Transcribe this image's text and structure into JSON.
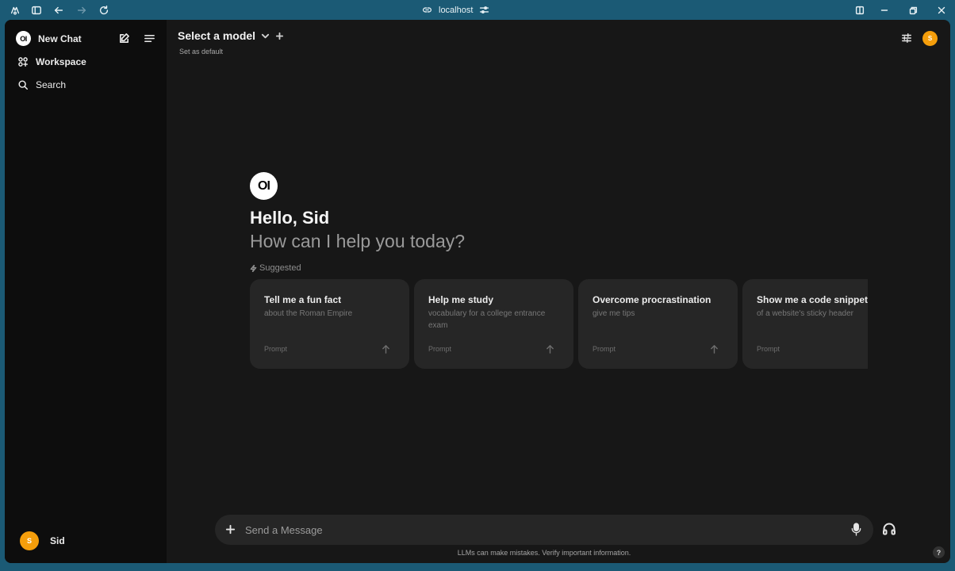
{
  "browser": {
    "url": "localhost",
    "icons": [
      "extensions-icon",
      "sidebar-toggle-icon",
      "back-arrow-icon",
      "forward-arrow-icon",
      "reload-icon",
      "link-icon",
      "settings-sliders-icon",
      "split-view-icon",
      "minimize-icon",
      "restore-icon",
      "close-icon"
    ]
  },
  "sidebar": {
    "logo": "OI",
    "new_chat": "New Chat",
    "workspace": "Workspace",
    "search": "Search",
    "user": {
      "initial": "S",
      "name": "Sid"
    }
  },
  "header": {
    "model_select": "Select a model",
    "set_default": "Set as default",
    "avatar_initial": "S"
  },
  "hero": {
    "logo": "OI",
    "greeting": "Hello, Sid",
    "subtitle": "How can I help you today?",
    "suggested_label": "Suggested"
  },
  "suggestions": [
    {
      "title": "Tell me a fun fact",
      "subtitle": "about the Roman Empire",
      "tag": "Prompt"
    },
    {
      "title": "Help me study",
      "subtitle": "vocabulary for a college entrance exam",
      "tag": "Prompt"
    },
    {
      "title": "Overcome procrastination",
      "subtitle": "give me tips",
      "tag": "Prompt"
    },
    {
      "title": "Show me a code snippet",
      "subtitle": "of a website's sticky header",
      "tag": "Prompt"
    }
  ],
  "composer": {
    "placeholder": "Send a Message",
    "disclaimer": "LLMs can make mistakes. Verify important information.",
    "help": "?"
  },
  "colors": {
    "titlebar": "#1b5a75",
    "sidebar": "#0d0d0d",
    "main": "#171717",
    "card": "#262626",
    "avatar": "#f59e0b"
  }
}
